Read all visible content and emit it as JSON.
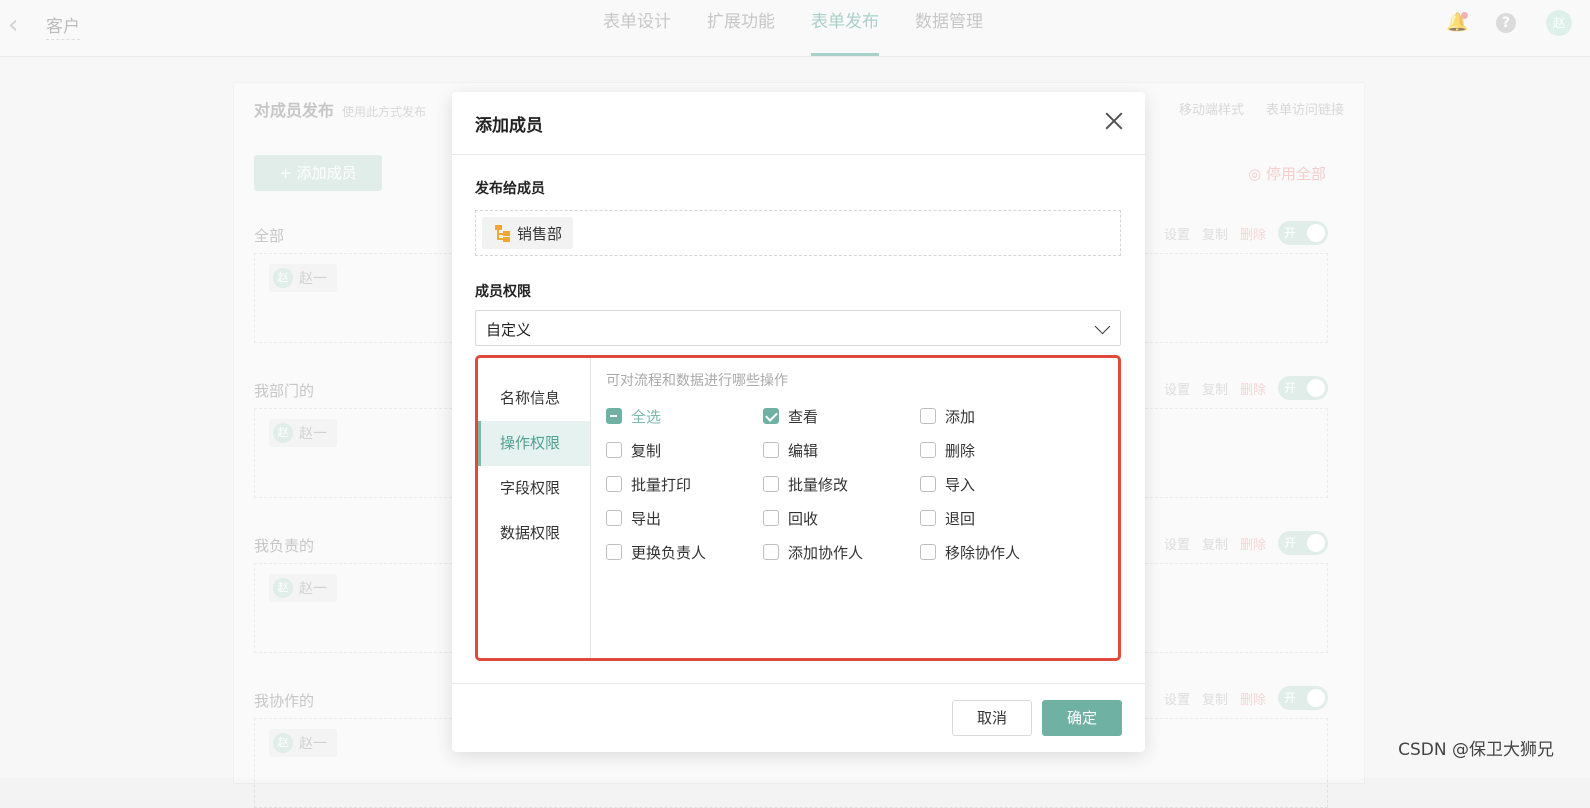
{
  "topbar": {
    "back_icon": "chevron-left-icon",
    "app_title": "客户",
    "tabs": [
      "表单设计",
      "扩展功能",
      "表单发布",
      "数据管理"
    ],
    "active_tab": "表单发布",
    "user_avatar": "赵"
  },
  "page": {
    "heading": "对成员发布",
    "heading_sub": "使用此方式发布",
    "links": [
      "移动端样式",
      "表单访问链接"
    ],
    "add_member_button": "+ 添加成员",
    "disable_all": "◎ 停用全部",
    "groups": [
      {
        "label": "全部",
        "member": "赵一"
      },
      {
        "label": "我部门的",
        "member": "赵一"
      },
      {
        "label": "我负责的",
        "member": "赵一"
      },
      {
        "label": "我协作的",
        "member": "赵一"
      }
    ],
    "group_actions": {
      "settings": "设置",
      "copy": "复制",
      "delete": "删除",
      "toggle": "开"
    },
    "member_avatar": "赵"
  },
  "modal": {
    "title": "添加成员",
    "publish_label": "发布给成员",
    "department_chip": "销售部",
    "permission_label": "成员权限",
    "permission_select_value": "自定义",
    "side_nav": [
      "名称信息",
      "操作权限",
      "字段权限",
      "数据权限"
    ],
    "active_side_nav": "操作权限",
    "operations_hint": "可对流程和数据进行哪些操作",
    "operations": [
      {
        "label": "全选",
        "state": "indeterminate"
      },
      {
        "label": "查看",
        "state": "checked"
      },
      {
        "label": "添加",
        "state": "unchecked"
      },
      {
        "label": "复制",
        "state": "unchecked"
      },
      {
        "label": "编辑",
        "state": "unchecked"
      },
      {
        "label": "删除",
        "state": "unchecked"
      },
      {
        "label": "批量打印",
        "state": "unchecked"
      },
      {
        "label": "批量修改",
        "state": "unchecked"
      },
      {
        "label": "导入",
        "state": "unchecked"
      },
      {
        "label": "导出",
        "state": "unchecked"
      },
      {
        "label": "回收",
        "state": "unchecked"
      },
      {
        "label": "退回",
        "state": "unchecked"
      },
      {
        "label": "更换负责人",
        "state": "unchecked"
      },
      {
        "label": "添加协作人",
        "state": "unchecked"
      },
      {
        "label": "移除协作人",
        "state": "unchecked"
      }
    ],
    "cancel_button": "取消",
    "ok_button": "确定"
  },
  "colors": {
    "accent": "#6fb2a4",
    "highlight_border": "#e04a3a"
  },
  "watermark": "CSDN @保卫大狮兄"
}
